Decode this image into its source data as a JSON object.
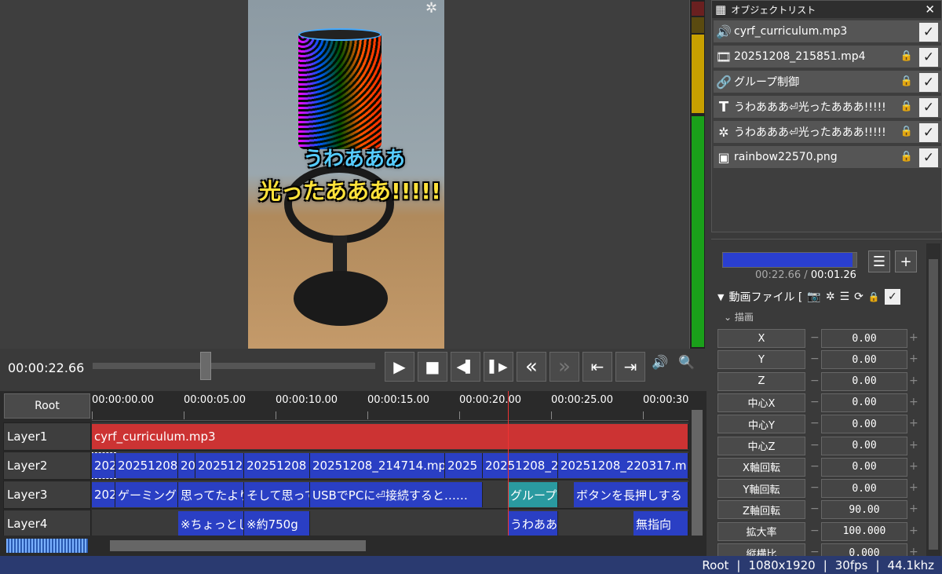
{
  "preview": {
    "caption_line1": "うわあああ",
    "caption_line2": "光ったあああ!!!!!",
    "sparkle_icon": "sparkle-icon"
  },
  "transport": {
    "current_time": "00:00:22.66",
    "seek_position": 0.4,
    "buttons": {
      "play": "▶",
      "stop": "■",
      "prev_frame": "◀▌",
      "next_frame": "▌▶",
      "rewind": "«",
      "fast_forward": "»",
      "to_start": "⇤",
      "to_end": "⇥",
      "volume": "🔊",
      "zoom": "🔍"
    }
  },
  "timeline": {
    "root_label": "Root",
    "ruler": [
      "00:00:00.00",
      "00:00:05.00",
      "00:00:10.00",
      "00:00:15.00",
      "00:00:20.00",
      "00:00:25.00",
      "00:00:30"
    ],
    "layers": [
      {
        "label": "Layer1"
      },
      {
        "label": "Layer2"
      },
      {
        "label": "Layer3"
      },
      {
        "label": "Layer4"
      }
    ],
    "layer1_clips": [
      "cyrf_curriculum.mp3"
    ],
    "layer2_clips": [
      "202",
      "20251208",
      "20",
      "202512",
      "20251208",
      "20251208_214714.mp",
      "2025",
      "20251208_2",
      "20251208_220317.m"
    ],
    "layer3_clips": [
      "202",
      "ゲーミングマ",
      "思ってたより",
      "そして思って",
      "USBでPCに⏎接続すると……",
      "グループ制",
      "ボタンを長押しする"
    ],
    "layer4_clips": [
      "※ちょっとし",
      "※約750g",
      "うわああ",
      "無指向"
    ]
  },
  "objlist": {
    "title": "オブジェクトリスト",
    "close_label": "✕",
    "items": [
      {
        "icon": "speaker-icon",
        "glyph": "🔊",
        "name": "cyrf_curriculum.mp3",
        "locked": false,
        "checked": true
      },
      {
        "icon": "film-icon",
        "glyph": "🎞",
        "name": "20251208_215851.mp4",
        "locked": true,
        "checked": true
      },
      {
        "icon": "link-icon",
        "glyph": "🔗",
        "name": "グループ制御",
        "locked": true,
        "checked": true
      },
      {
        "icon": "text-icon",
        "glyph": "T",
        "name": "うわあああ⏎光ったあああ!!!!!",
        "locked": true,
        "checked": true
      },
      {
        "icon": "effect-icon",
        "glyph": "✲",
        "name": "うわあああ⏎光ったあああ!!!!!",
        "locked": true,
        "checked": true
      },
      {
        "icon": "image-icon",
        "glyph": "▣",
        "name": "rainbow22570.png",
        "locked": true,
        "checked": true
      }
    ]
  },
  "props": {
    "time_current": "00:22.66",
    "time_sep": "/",
    "time_total": "00:01.26",
    "progress": 0.97,
    "object_name": "動画ファイル [",
    "section_label": "描画",
    "rows": [
      {
        "name": "X",
        "value": "0.00"
      },
      {
        "name": "Y",
        "value": "0.00"
      },
      {
        "name": "Z",
        "value": "0.00"
      },
      {
        "name": "中心X",
        "value": "0.00"
      },
      {
        "name": "中心Y",
        "value": "0.00"
      },
      {
        "name": "中心Z",
        "value": "0.00"
      },
      {
        "name": "X軸回転",
        "value": "0.00"
      },
      {
        "name": "Y軸回転",
        "value": "0.00"
      },
      {
        "name": "Z軸回転",
        "value": "90.00"
      },
      {
        "name": "拡大率",
        "value": "100.000"
      },
      {
        "name": "縦横比",
        "value": "0.000"
      }
    ]
  },
  "status": {
    "scene": "Root",
    "resolution": "1080x1920",
    "fps": "30fps",
    "audio": "44.1khz",
    "separator": "|"
  },
  "colors": {
    "accent_blue": "#2a3fc4",
    "audio_red": "#cc3333",
    "status_bar": "#2a3a70",
    "meter_green": "#1aa01a",
    "meter_yellow": "#c8a000"
  }
}
